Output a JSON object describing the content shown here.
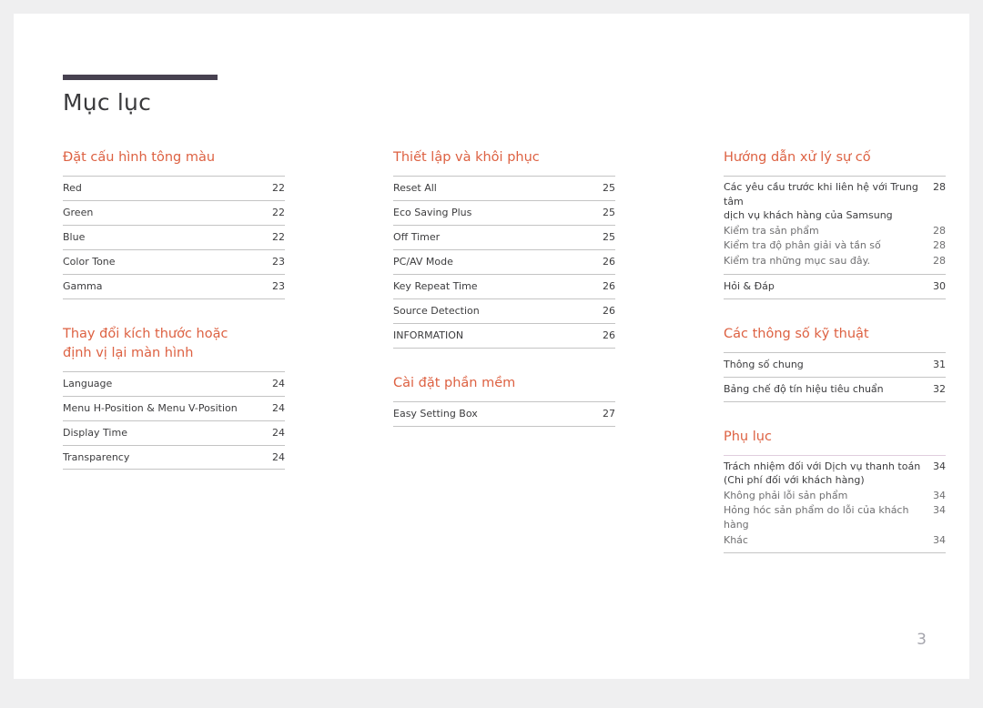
{
  "document": {
    "title": "Mục lục",
    "page_number": "3",
    "accent_color": "#dd6142",
    "rule_color": "#474150"
  },
  "columns": [
    {
      "name": "column-1",
      "sections": [
        {
          "title": "Đặt cấu hình tông màu",
          "style": "ruled",
          "entries": [
            {
              "label": "Red",
              "page": "22"
            },
            {
              "label": "Green",
              "page": "22"
            },
            {
              "label": "Blue",
              "page": "22"
            },
            {
              "label": "Color Tone",
              "page": "23"
            },
            {
              "label": "Gamma",
              "page": "23"
            }
          ]
        },
        {
          "title": "Thay đổi kích thước hoặc\nđịnh vị lại màn hình",
          "style": "ruled",
          "entries": [
            {
              "label": "Language",
              "page": "24"
            },
            {
              "label": "Menu H-Position & Menu V-Position",
              "page": "24"
            },
            {
              "label": "Display Time",
              "page": "24"
            },
            {
              "label": "Transparency",
              "page": "24"
            }
          ]
        }
      ]
    },
    {
      "name": "column-2",
      "sections": [
        {
          "title": "Thiết lập và khôi phục",
          "style": "ruled",
          "entries": [
            {
              "label": "Reset All",
              "page": "25"
            },
            {
              "label": "Eco Saving Plus",
              "page": "25"
            },
            {
              "label": "Off Timer",
              "page": "25"
            },
            {
              "label": "PC/AV Mode",
              "page": "26"
            },
            {
              "label": "Key Repeat Time",
              "page": "26"
            },
            {
              "label": "Source Detection",
              "page": "26"
            },
            {
              "label": "INFORMATION",
              "page": "26"
            }
          ]
        },
        {
          "title": "Cài đặt phần mềm",
          "style": "ruled",
          "entries": [
            {
              "label": "Easy Setting Box",
              "page": "27"
            }
          ]
        }
      ]
    },
    {
      "name": "column-3",
      "sections": [
        {
          "title": "Hướng dẫn xử lý sự cố",
          "style": "grouped",
          "entries": [
            {
              "label": "Các yêu cầu trước khi liên hệ với Trung tâm\ndịch vụ khách hàng của Samsung",
              "page": "28",
              "kind": "lead"
            },
            {
              "label": "Kiểm tra sản phẩm",
              "page": "28",
              "kind": "sub"
            },
            {
              "label": "Kiểm tra độ phân giải và tần số",
              "page": "28",
              "kind": "sub"
            },
            {
              "label": "Kiểm tra những mục sau đây.",
              "page": "28",
              "kind": "sub"
            }
          ],
          "tail_entries": [
            {
              "label": "Hỏi & Đáp",
              "page": "30"
            }
          ]
        },
        {
          "title": "Các thông số kỹ thuật",
          "style": "ruled",
          "entries": [
            {
              "label": "Thông số chung",
              "page": "31"
            },
            {
              "label": "Bảng chế độ tín hiệu tiêu chuẩn",
              "page": "32"
            }
          ]
        },
        {
          "title": "Phụ lục",
          "style": "grouped-tint",
          "entries": [
            {
              "label": "Trách nhiệm đối với Dịch vụ thanh toán\n(Chi phí đối với khách hàng)",
              "page": "34",
              "kind": "lead"
            },
            {
              "label": "Không phải lỗi sản phẩm",
              "page": "34",
              "kind": "sub"
            },
            {
              "label": "Hỏng hóc sản phẩm do lỗi của khách hàng",
              "page": "34",
              "kind": "sub"
            },
            {
              "label": "Khác",
              "page": "34",
              "kind": "sub"
            }
          ]
        }
      ]
    }
  ]
}
